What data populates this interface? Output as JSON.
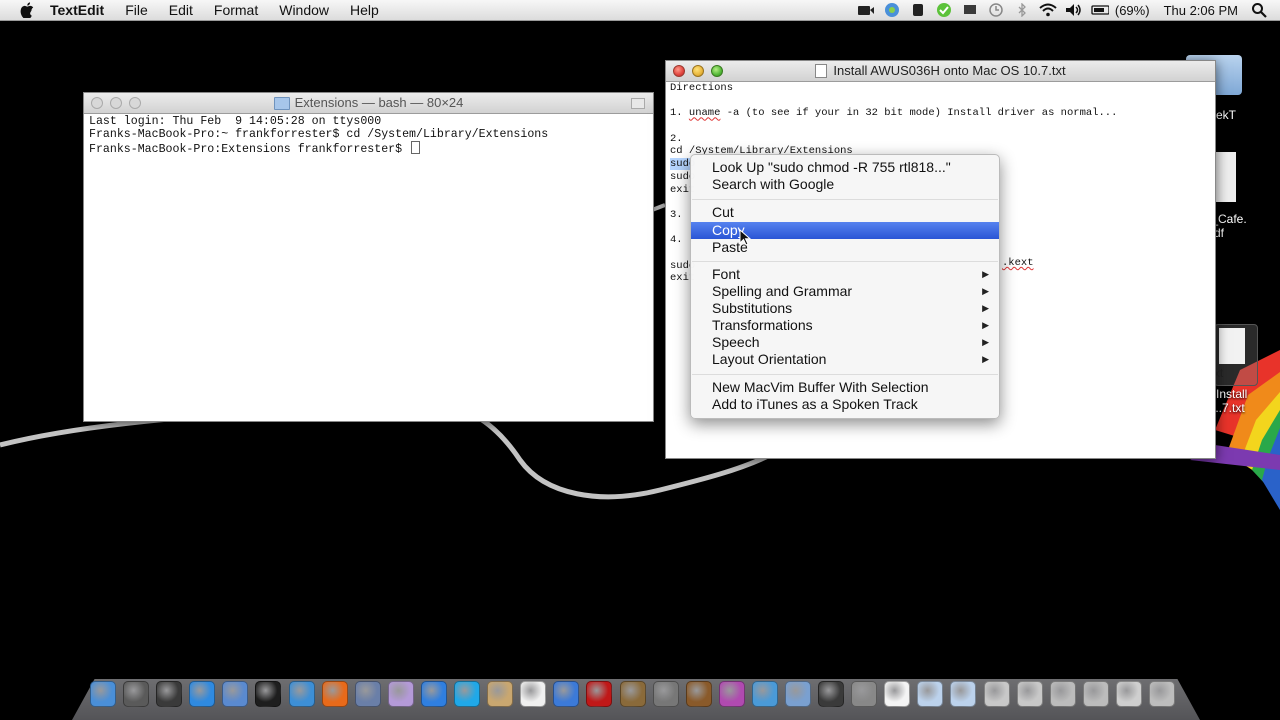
{
  "menubar": {
    "app_name": "TextEdit",
    "menus": [
      "File",
      "Edit",
      "Format",
      "Window",
      "Help"
    ],
    "battery": "(69%)",
    "clock": "Thu 2:06 PM"
  },
  "terminal": {
    "title": "Extensions — bash — 80×24",
    "lines": [
      "Last login: Thu Feb  9 14:05:28 on ttys000",
      "Franks-MacBook-Pro:~ frankforrester$ cd /System/Library/Extensions",
      "Franks-MacBook-Pro:Extensions frankforrester$ "
    ]
  },
  "textedit": {
    "title": "Install AWUS036H onto Mac OS 10.7.txt",
    "lines": [
      "Directions",
      "",
      "1. uname -a (to see if your in 32 bit mode) Install driver as normal...",
      "",
      "2.",
      "cd /System/Library/Extensions",
      "sudo",
      "sudo",
      "exit",
      "",
      "3.",
      "",
      "4. r",
      "",
      "sudo",
      "exit"
    ],
    "visible_fragment": ".kext"
  },
  "context_menu": {
    "items": [
      {
        "label": "Look Up \"sudo chmod -R 755 rtl818...\"",
        "submenu": false
      },
      {
        "label": "Search with Google",
        "submenu": false
      },
      {
        "label": "Cut",
        "submenu": false
      },
      {
        "label": "Copy",
        "submenu": false,
        "highlighted": true
      },
      {
        "label": "Paste",
        "submenu": false
      },
      {
        "label": "Font",
        "submenu": true
      },
      {
        "label": "Spelling and Grammar",
        "submenu": true
      },
      {
        "label": "Substitutions",
        "submenu": true
      },
      {
        "label": "Transformations",
        "submenu": true
      },
      {
        "label": "Speech",
        "submenu": true
      },
      {
        "label": "Layout Orientation",
        "submenu": true
      },
      {
        "label": "New MacVim Buffer With Selection",
        "submenu": false
      },
      {
        "label": "Add to iTunes as a Spoken Track",
        "submenu": false
      }
    ]
  },
  "desktop_icons": [
    {
      "label": "ekT"
    },
    {
      "label": "t_Cafe."
    },
    {
      "label": "df"
    },
    {
      "label": "xt"
    },
    {
      "label": "Install"
    },
    {
      "label": "...7.txt"
    }
  ],
  "dock": {
    "icons": [
      "finder-icon",
      "launchpad-icon",
      "dashboard-icon",
      "app-store-icon",
      "preview-icon",
      "terminal-icon",
      "safari-icon",
      "firefox-icon",
      "xcode-icon",
      "onion-icon",
      "dropbox-icon",
      "skype-icon",
      "address-book-icon",
      "ical-icon",
      "itunes-icon",
      "photo-booth-icon",
      "iphoto-icon",
      "system-preferences-icon",
      "adium-icon",
      "itunes-dj-icon",
      "ftp-icon",
      "preview-2-icon",
      "imovie-icon",
      "image-capture-icon",
      "textedit-icon",
      "folder-1-icon",
      "folder-2-icon",
      "folder-3-icon",
      "folder-4-icon",
      "folder-5-icon",
      "folder-6-icon",
      "folder-7-icon",
      "trash-icon"
    ],
    "colors": [
      "#4a8fd8",
      "#5a5a5a",
      "#3a3a3a",
      "#2f8ae0",
      "#5a8ad0",
      "#1e1e1e",
      "#3d8fd6",
      "#e86a1a",
      "#6a7fa8",
      "#b49ad8",
      "#2f7fe0",
      "#20a8e8",
      "#c9a770",
      "#f0f0f0",
      "#3c7ad8",
      "#c01818",
      "#8a6a3a",
      "#777",
      "#8a5a2a",
      "#b04ab0",
      "#4a9ad8",
      "#7aa0d0",
      "#3a3a3a",
      "#888",
      "#f4f4f4",
      "#bcd2ec",
      "#bcd2ec",
      "#c8c8c8",
      "#c8c8c8",
      "#bcbcbc",
      "#bcbcbc",
      "#cfcfcf",
      "#bdbdbd"
    ]
  }
}
